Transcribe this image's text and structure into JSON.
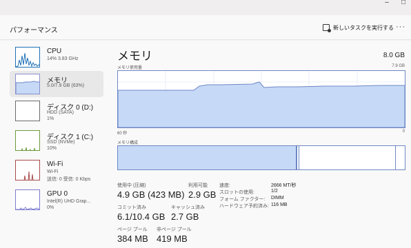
{
  "window_controls": {
    "minimize": "–",
    "maximize": "□"
  },
  "header": {
    "title": "パフォーマンス",
    "run_task_label": "新しいタスクを実行する",
    "more_label": "···"
  },
  "sidebar": {
    "items": [
      {
        "name": "CPU",
        "sub1": "14%  3.83 GHz",
        "sub2": "",
        "sub3": ""
      },
      {
        "name": "メモリ",
        "sub1": "5.0/7.9 GB (63%)",
        "sub2": "",
        "sub3": ""
      },
      {
        "name": "ディスク 0 (D:)",
        "sub1": "HDD (SATA)",
        "sub2": "1%",
        "sub3": ""
      },
      {
        "name": "ディスク 1 (C:)",
        "sub1": "SSD (NVMe)",
        "sub2": "10%",
        "sub3": ""
      },
      {
        "name": "Wi-Fi",
        "sub1": "Wi-Fi",
        "sub2": "送信: 0 受信: 0 Kbps",
        "sub3": ""
      },
      {
        "name": "GPU 0",
        "sub1": "Intel(R) UHD Grap...",
        "sub2": "0%",
        "sub3": ""
      }
    ]
  },
  "main": {
    "title": "メモリ",
    "total": "8.0 GB",
    "usage_label": "メモリ使用量",
    "usage_max": "7.9 GB",
    "time_left": "60 秒",
    "time_right": "0",
    "composition_label": "メモリ構成",
    "usage_fraction": 0.63
  },
  "stats": {
    "in_use_label": "使用中 (圧縮)",
    "in_use_value": "4.9 GB (423 MB)",
    "available_label": "利用可能",
    "available_value": "2.9 GB",
    "committed_label": "コミット済み",
    "committed_value": "6.1/10.4 GB",
    "cached_label": "キャッシュ済み",
    "cached_value": "2.7 GB",
    "paged_label": "ページ プール",
    "paged_value": "384 MB",
    "nonpaged_label": "非ページ プール",
    "nonpaged_value": "419 MB"
  },
  "details": [
    {
      "key": "速度:",
      "value": "2666 MT/秒"
    },
    {
      "key": "スロットの使用:",
      "value": "1/2"
    },
    {
      "key": "フォーム ファクター:",
      "value": "DIMM"
    },
    {
      "key": "ハードウェア予約済み:",
      "value": "116 MB"
    }
  ],
  "colors": {
    "memory_fill": "#c6d9f6",
    "memory_line": "#6d87c5",
    "cpu_line": "#1e70b8",
    "wifi_line": "#a84a4a"
  }
}
